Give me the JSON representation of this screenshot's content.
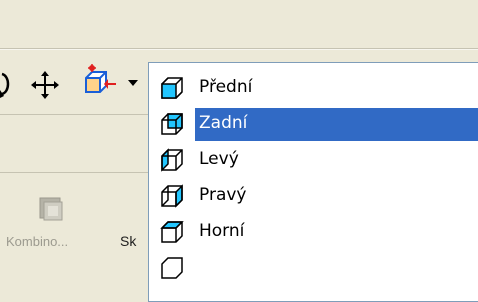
{
  "toolbar": {
    "icons": [
      "rotate-icon",
      "pan-icon",
      "view-cube-icon",
      "dropdown-arrow-icon"
    ]
  },
  "ribbon": {
    "kombino_label": "Kombino...",
    "sk_label": "Sk"
  },
  "view_menu": {
    "items": [
      {
        "label": "Přední",
        "selected": false,
        "icon": "front-view-icon"
      },
      {
        "label": "Zadní",
        "selected": true,
        "icon": "back-view-icon"
      },
      {
        "label": "Levý",
        "selected": false,
        "icon": "left-view-icon"
      },
      {
        "label": "Pravý",
        "selected": false,
        "icon": "right-view-icon"
      },
      {
        "label": "Horní",
        "selected": false,
        "icon": "top-view-icon"
      }
    ]
  },
  "colors": {
    "selection": "#316ac5",
    "face_highlight": "#22c6ff",
    "dropdown_border": "#7f9db9"
  }
}
